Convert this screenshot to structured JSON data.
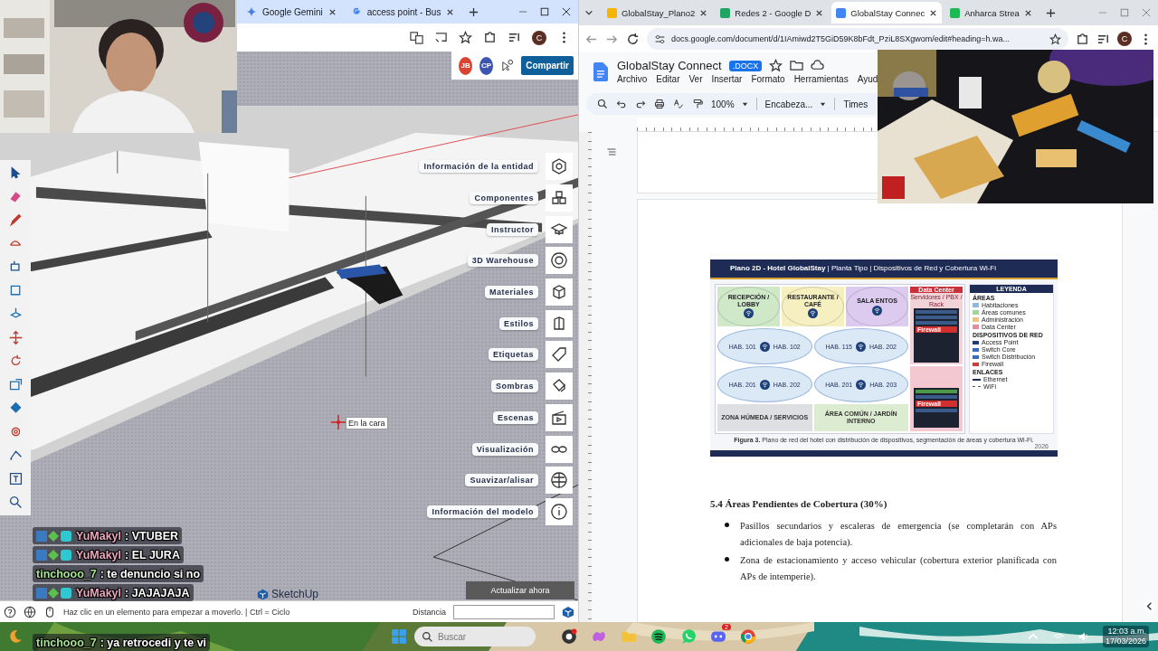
{
  "left_browser": {
    "tabs": [
      {
        "label": "Google Gemini"
      },
      {
        "label": "access point - Bus"
      }
    ],
    "avatar": "C"
  },
  "sketchup": {
    "collaborators": [
      {
        "initials": "JB",
        "color": "#d9432f"
      },
      {
        "initials": "CP",
        "color": "#3d55b0"
      }
    ],
    "share_button": "Compartir",
    "tray": [
      "Información de la entidad",
      "Componentes",
      "Instructor",
      "3D Warehouse",
      "Materiales",
      "Estilos",
      "Etiquetas",
      "Sombras",
      "Escenas",
      "Visualización",
      "Suavizar/alisar",
      "Información del modelo"
    ],
    "tooltip": "En la cara",
    "logo": "SketchUp",
    "update_button": "Actualizar ahora",
    "status_text": "Haz clic en un elemento para empezar a moverlo. | Ctrl = Ciclo",
    "distance_label": "Distancia"
  },
  "right_browser": {
    "tabs": [
      {
        "label": "GlobalStay_Plano2",
        "selected": false
      },
      {
        "label": "Redes 2 - Google D",
        "selected": false
      },
      {
        "label": "GlobalStay Connec",
        "selected": true
      },
      {
        "label": "Anharca Strea",
        "selected": false
      }
    ],
    "url": "docs.google.com/document/d/1IAmiwd2T5GiD59K8bFdt_PziL8SXgwom/edit#heading=h.wa...",
    "avatar": "C"
  },
  "document": {
    "title": "GlobalStay Connect",
    "badge": ".DOCX",
    "menu": [
      "Archivo",
      "Editar",
      "Ver",
      "Insertar",
      "Formato",
      "Herramientas",
      "Ayud"
    ],
    "zoom": "100%",
    "style": "Encabeza...",
    "font": "Times",
    "figure": {
      "title": "**Plano 2D - Hotel GlobalStay** | Planta Tipo | Dispositivos de Red y Cobertura Wi-Fi",
      "areas": [
        {
          "label": "RECEPCIÓN / LOBBY",
          "color": "#cfe8c8"
        },
        {
          "label": "RESTAURANTE / CAFÉ",
          "color": "#f6efc0"
        },
        {
          "label": "SALA ENTOS",
          "color": "#dccbef"
        }
      ],
      "rooms": [
        [
          "HAB. 101",
          "HAB. 102"
        ],
        [
          "HAB. 115",
          "HAB. 202"
        ],
        [
          "HAB. 201",
          "HAB. 202"
        ],
        [
          "HAB. 201",
          "HAB. 203"
        ]
      ],
      "zones": [
        {
          "label": "ZONA HÚMEDA / SERVICIOS",
          "color": "#dedfe3"
        },
        {
          "label": "ÁREA COMÚN / JARDÍN INTERNO",
          "color": "#dcecd0"
        }
      ],
      "data_center": "Data Center",
      "data_center_sub": "Servidores / PBX / Rack",
      "firewalls": [
        "Firewall",
        "Firewall"
      ],
      "legend": {
        "title": "LEYENDA",
        "areas_title": "ÁREAS",
        "areas": [
          {
            "label": "Habitaciones",
            "color": "#8cb8e6"
          },
          {
            "label": "Áreas comunes",
            "color": "#9fd49a"
          },
          {
            "label": "Administración",
            "color": "#f3c27a"
          },
          {
            "label": "Data Center",
            "color": "#e88b98"
          }
        ],
        "devices_title": "DISPOSITIVOS DE RED",
        "devices": [
          {
            "label": "Access Point",
            "color": "#1d3f7a"
          },
          {
            "label": "Switch Core",
            "color": "#2f6fc0"
          },
          {
            "label": "Switch Distribución",
            "color": "#2f6fc0"
          },
          {
            "label": "Firewall",
            "color": "#d23a3a"
          }
        ],
        "links_title": "ENLACES",
        "links": [
          {
            "label": "Ethernet",
            "dashed": false
          },
          {
            "label": "WiFi",
            "dashed": true
          }
        ]
      },
      "caption": "**Figura 3.** Plano de red del hotel con distribución de dispositivos, segmentación de áreas y cobertura Wi-Fi.",
      "year": "2026"
    },
    "heading": "5.4 Áreas Pendientes de Cobertura (30%)",
    "bullets": [
      "Pasillos secundarios y escaleras de emergencia (se completarán con APs adicionales de baja potencia).",
      "Zona de estacionamiento y acceso vehicular (cobertura exterior planificada con APs de intemperie)."
    ]
  },
  "chat": [
    {
      "user": "YuMakyl",
      "text": ": VTUBER",
      "color": "#e9a6bd",
      "badges": true
    },
    {
      "user": "YuMakyl",
      "text": ": EL JURA",
      "color": "#e9a6bd",
      "badges": true
    },
    {
      "user": "tinchooo_7",
      "text": ": te denuncio si no",
      "color": "#a4e38e",
      "badges": false
    },
    {
      "user": "YuMakyl",
      "text": ": JAJAJAJA",
      "color": "#e9a6bd",
      "badges": true
    },
    {
      "user": "tinchooo_7",
      "text": ": ya retrocedi y te vi",
      "color": "#a4e38e",
      "badges": false
    }
  ],
  "taskbar": {
    "search_placeholder": "Buscar",
    "discord_badge": "2",
    "time": "12:03 a.m.",
    "date": "17/03/2026"
  }
}
